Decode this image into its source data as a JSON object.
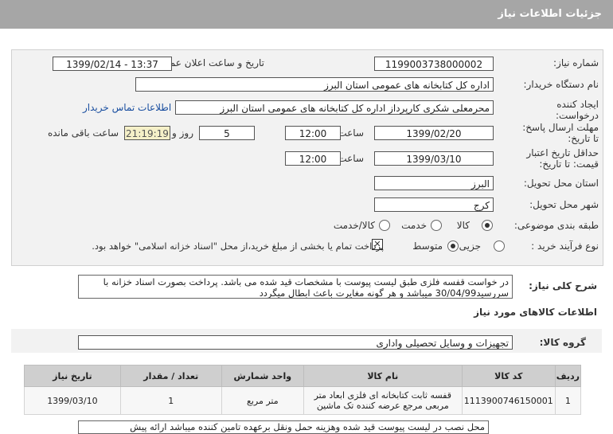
{
  "header": {
    "title": "جزئیات اطلاعات نیاز"
  },
  "form": {
    "need_number_label": "شماره نیاز:",
    "need_number": "1199003738000002",
    "announce_label": "تاریخ و ساعت اعلان عمومی:",
    "announce_value": "1399/02/14 - 13:37",
    "buyer_org_label": "نام دستگاه خریدار:",
    "buyer_org": "اداره کل کتابخانه های عمومی استان البرز",
    "creator_label_1": "ایجاد کننده",
    "creator_label_2": "درخواست:",
    "creator": "محرمعلی شکری کارپرداز اداره کل کتابخانه های عمومی استان البرز",
    "contact_link": "اطلاعات تماس خریدار",
    "reply_label_1": "مهلت ارسال پاسخ:",
    "reply_label_2": "تا تاریخ:",
    "reply_date": "1399/02/20",
    "hour_label": "ساعت",
    "reply_time": "12:00",
    "days_value": "5",
    "days_label": "روز و",
    "timer": "21:19:19",
    "remaining_label": "ساعت باقی مانده",
    "validity_label_1": "حداقل تاریخ اعتبار",
    "validity_label_2": "قیمت: تا تاریخ:",
    "validity_date": "1399/03/10",
    "validity_hour_label": "ساعت",
    "validity_time": "12:00",
    "province_label": "استان محل تحویل:",
    "province": "البرز",
    "city_label": "شهر محل تحویل:",
    "city": "کرج",
    "category_label": "طبقه بندی موضوعی:",
    "cat_goods": "کالا",
    "cat_service": "خدمت",
    "cat_goods_service": "کالا/خدمت",
    "process_label": "نوع فرآیند خرید :",
    "proc_partial": "جزیی",
    "proc_medium": "متوسط",
    "payment_note": "پرداخت تمام یا بخشی از مبلغ خرید،از محل \"اسناد خزانه اسلامی\" خواهد بود."
  },
  "description": {
    "label": "شرح کلی نیاز:",
    "text": "در خواست قفسه فلزی طبق لیست پیوست با مشخصات قید شده می باشد. پرداخت بصورت اسناد خزانه با سررسید30/04/99 میباشد و هر گونه مغایرت باعث ابطال میگردد"
  },
  "goods_info": {
    "title": "اطلاعات کالاهای مورد نیاز",
    "group_label": "گروه کالا:",
    "group_value": "تجهیزات و وسایل تحصیلی واداری"
  },
  "table": {
    "headers": [
      "ردیف",
      "کد کالا",
      "نام کالا",
      "واحد شمارش",
      "تعداد / مقدار",
      "تاریخ نیاز"
    ],
    "rows": [
      [
        "1",
        "1113900746150001",
        "قفسه ثابت کتابخانه ای فلزی ابعاد متر مربعی مرجع عرضه کننده تک ماشین",
        "متر مربع",
        "1",
        "1399/03/10"
      ]
    ]
  },
  "footer_note": "محل نصب در لیست پیوست قید شده وهزینه حمل ونقل برعهده تامین کننده میباشد ارائه پیش"
}
